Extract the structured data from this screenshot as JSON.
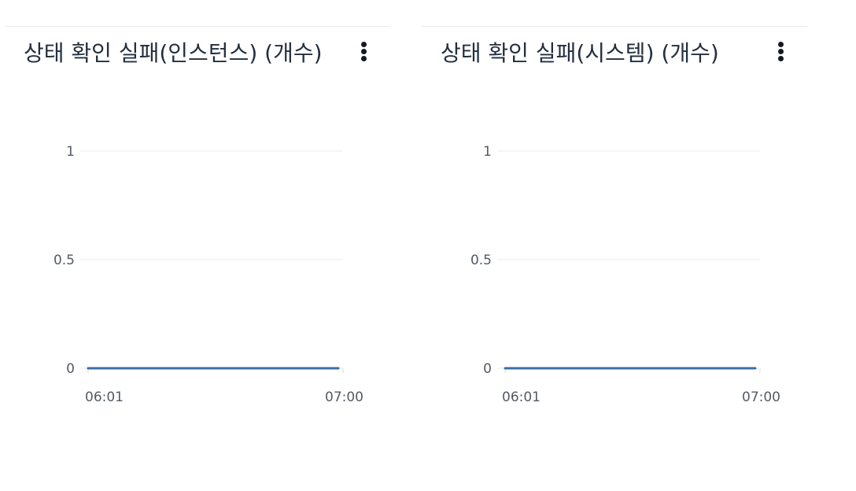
{
  "panels": [
    {
      "title": "상태 확인 실패(인스턴스) (개수)",
      "menu_icon": "vertical-ellipsis-icon"
    },
    {
      "title": "상태 확인 실패(시스템) (개수)",
      "menu_icon": "vertical-ellipsis-icon"
    }
  ],
  "chart_data": [
    {
      "type": "line",
      "title": "상태 확인 실패(인스턴스) (개수)",
      "xlabel": "",
      "ylabel": "",
      "x_ticks": [
        "06:01",
        "07:00"
      ],
      "y_ticks": [
        "0",
        "0.5",
        "1"
      ],
      "ylim": [
        0,
        1
      ],
      "grid": true,
      "series": [
        {
          "color": "#3b6ea8",
          "x": [
            "06:01",
            "07:00"
          ],
          "values": [
            0,
            0
          ]
        }
      ]
    },
    {
      "type": "line",
      "title": "상태 확인 실패(시스템) (개수)",
      "xlabel": "",
      "ylabel": "",
      "x_ticks": [
        "06:01",
        "07:00"
      ],
      "y_ticks": [
        "0",
        "0.5",
        "1"
      ],
      "ylim": [
        0,
        1
      ],
      "grid": true,
      "series": [
        {
          "color": "#3b6ea8",
          "x": [
            "06:01",
            "07:00"
          ],
          "values": [
            0,
            0
          ]
        }
      ]
    }
  ]
}
